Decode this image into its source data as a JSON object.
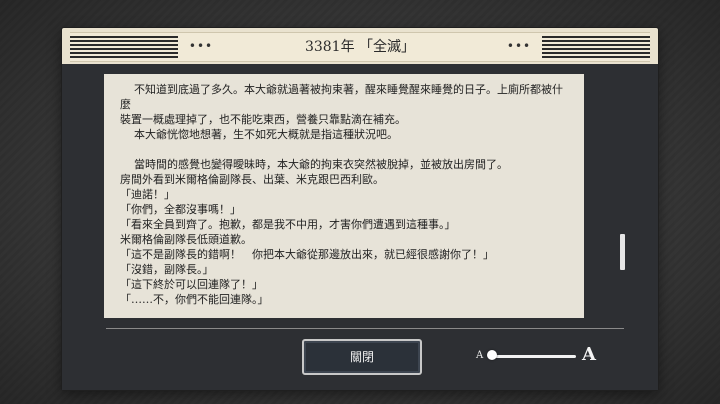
{
  "header": {
    "title": "3381年 「全滅」",
    "dots_left": "•••",
    "dots_right": "•••"
  },
  "story": {
    "lines": [
      "    不知道到底過了多久。本大爺就過著被拘束著，醒來睡覺醒來睡覺的日子。上廁所都被什麼",
      "裝置一概處理掉了，也不能吃東西，營養只靠點滴在補充。",
      "    本大爺恍惚地想著，生不如死大概就是指這種狀況吧。",
      "",
      "    當時間的感覺也變得曖昧時，本大爺的拘束衣突然被脫掉，並被放出房間了。",
      "房間外看到米爾格倫副隊長、出葉、米克跟巴西利歐。",
      "「迪諾！」",
      "「你們，全都沒事嗎！」",
      "「看來全員到齊了。抱歉，都是我不中用，才害你們遭遇到這種事。」",
      "米爾格倫副隊長低頭道歉。",
      "「這不是副隊長的錯啊！　你把本大爺從那邊放出來，就已經很感謝你了！」",
      "「沒錯，副隊長。」",
      "「這下終於可以回連隊了！」",
      "「……不，你們不能回連隊。」"
    ]
  },
  "controls": {
    "close_label": "關閉",
    "font_small_label": "A",
    "font_large_label": "A",
    "font_size_level": 0.0
  },
  "colors": {
    "panel": "#2d2f33",
    "paper": "#e7e3d8",
    "frame": "#e9e2cf"
  }
}
